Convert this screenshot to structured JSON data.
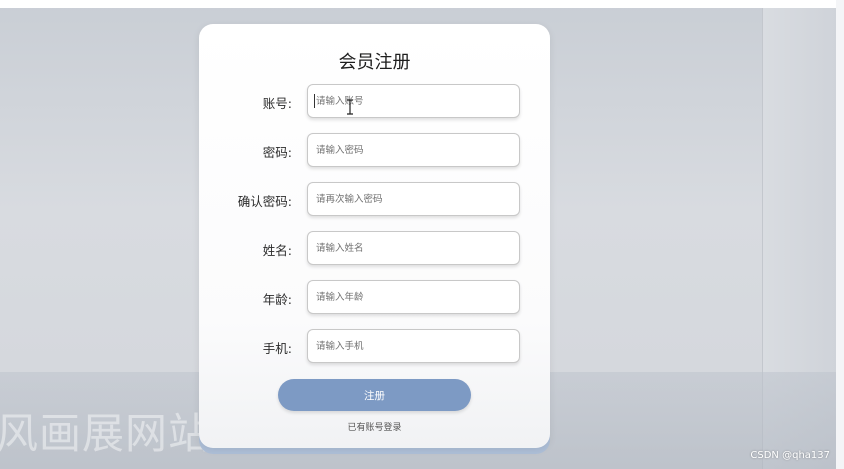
{
  "background": {
    "watermark": "风画展网站",
    "credit": "CSDN @qha137"
  },
  "form": {
    "title": "会员注册",
    "fields": [
      {
        "label": "账号:",
        "placeholder": "请输入账号"
      },
      {
        "label": "密码:",
        "placeholder": "请输入密码"
      },
      {
        "label": "确认密码:",
        "placeholder": "请再次输入密码"
      },
      {
        "label": "姓名:",
        "placeholder": "请输入姓名"
      },
      {
        "label": "年龄:",
        "placeholder": "请输入年龄"
      },
      {
        "label": "手机:",
        "placeholder": "请输入手机"
      }
    ],
    "submit_label": "注册",
    "login_link": "已有账号登录"
  },
  "colors": {
    "accent": "#7d9ac4",
    "card_underlay": "#aebfd8"
  }
}
